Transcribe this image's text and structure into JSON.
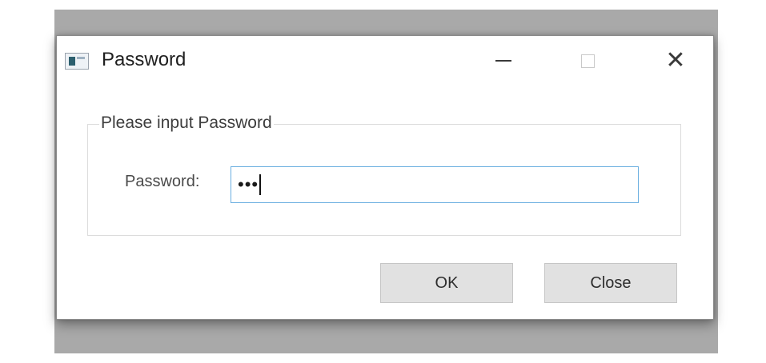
{
  "window": {
    "title": "Password",
    "controls": {
      "minimize_icon": "minimize-icon",
      "maximize_icon": "maximize-icon",
      "close_icon": "close-icon",
      "close_glyph": "✕"
    }
  },
  "group": {
    "legend": "Please input Password"
  },
  "form": {
    "password_label": "Password:",
    "password_value_masked": "•••"
  },
  "buttons": {
    "ok_label": "OK",
    "close_label": "Close"
  },
  "colors": {
    "input_focus_border": "#6aaee0",
    "button_bg": "#e1e1e1",
    "backdrop": "#a9a9a9"
  }
}
